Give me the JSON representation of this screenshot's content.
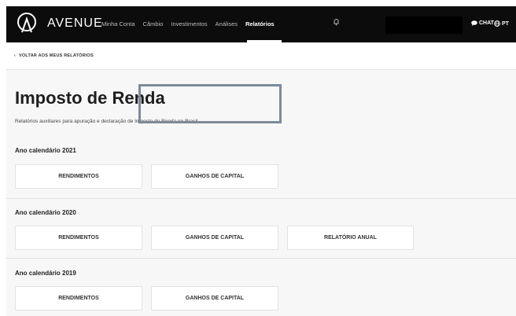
{
  "header": {
    "brand": "AVENUE",
    "nav": [
      "Minha Conta",
      "Câmbio",
      "Investimentos",
      "Análises",
      "Relatórios"
    ],
    "chat_label": "CHAT",
    "lang_label": "PT"
  },
  "subnav": {
    "back_label": "VOLTAR AOS MEUS RELATÓRIOS"
  },
  "main": {
    "title": "Imposto de Renda",
    "subtitle": "Relatórios auxiliares para apuração e declaração de Imposto de Renda no Brasil",
    "years": [
      {
        "label": "Ano calendário 2021",
        "cards": [
          "RENDIMENTOS",
          "GANHOS DE CAPITAL"
        ]
      },
      {
        "label": "Ano calendário 2020",
        "cards": [
          "RENDIMENTOS",
          "GANHOS DE CAPITAL",
          "RELATÓRIO ANUAL"
        ]
      },
      {
        "label": "Ano calendário 2019",
        "cards": [
          "RENDIMENTOS",
          "GANHOS DE CAPITAL"
        ]
      }
    ]
  }
}
